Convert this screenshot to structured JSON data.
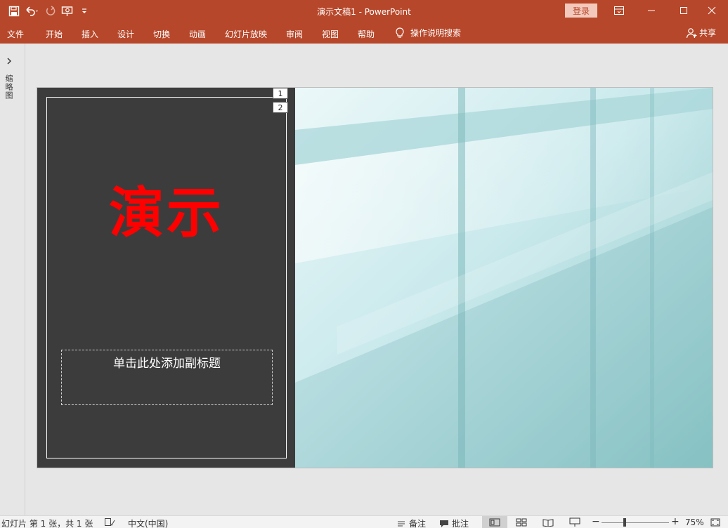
{
  "window": {
    "title": "演示文稿1  -  PowerPoint",
    "signin_label": "登录"
  },
  "menu": {
    "items": [
      "文件",
      "开始",
      "插入",
      "设计",
      "切换",
      "动画",
      "幻灯片放映",
      "审阅",
      "视图",
      "帮助"
    ],
    "tell_me": "操作说明搜索",
    "share": "共享"
  },
  "thumbnails": {
    "label": "缩略图"
  },
  "slide": {
    "title": "演示",
    "subtitle_placeholder": "单击此处添加副标题",
    "order_badges": [
      "1",
      "2"
    ],
    "title_color": "#ff0000",
    "background_color": "#3c3c3c"
  },
  "status": {
    "slide_info": "幻灯片 第 1 张，共 1 张",
    "language": "中文(中国)",
    "notes": "备注",
    "comments": "批注",
    "zoom": "75%"
  },
  "colors": {
    "accent": "#b7472a",
    "signin_bg": "#f4c9bd"
  }
}
